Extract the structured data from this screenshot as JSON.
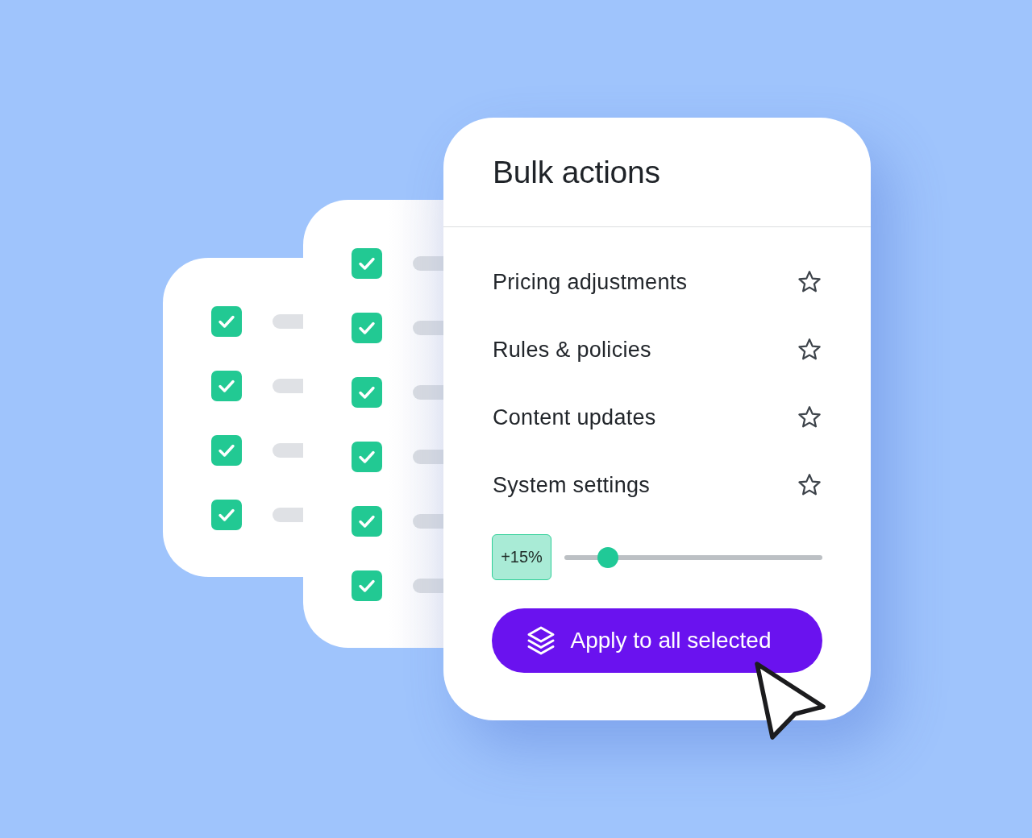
{
  "back_cards": [
    {
      "rows": [
        {
          "checked": true
        },
        {
          "checked": true
        },
        {
          "checked": true
        },
        {
          "checked": true
        }
      ]
    },
    {
      "rows": [
        {
          "checked": true
        },
        {
          "checked": true
        },
        {
          "checked": true
        },
        {
          "checked": true
        },
        {
          "checked": true
        },
        {
          "checked": true
        }
      ]
    }
  ],
  "panel": {
    "title": "Bulk actions",
    "actions": [
      {
        "label": "Pricing adjustments",
        "starred": false
      },
      {
        "label": "Rules & policies",
        "starred": false
      },
      {
        "label": "Content updates",
        "starred": false
      },
      {
        "label": "System settings",
        "starred": false
      }
    ],
    "adjustment": {
      "value": "+15%",
      "level": 0.17
    },
    "apply_button": {
      "label": "Apply to all selected"
    }
  }
}
